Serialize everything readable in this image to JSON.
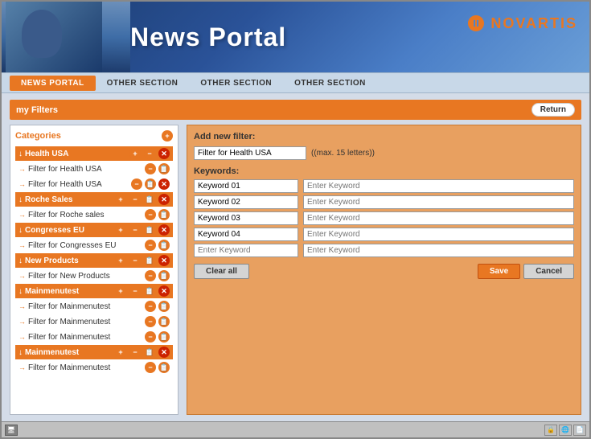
{
  "header": {
    "title": "News Portal",
    "logo_text": "NOVARTIS"
  },
  "nav": {
    "items": [
      {
        "label": "NEWS PORTAL",
        "active": true
      },
      {
        "label": "OTHER SECTION",
        "active": false
      },
      {
        "label": "OTHER SECTION",
        "active": false
      },
      {
        "label": "OTHER SECTION",
        "active": false
      }
    ]
  },
  "page": {
    "my_filters_label": "my Filters",
    "return_label": "Return"
  },
  "categories": {
    "label": "Categories",
    "groups": [
      {
        "name": "Health USA",
        "items": [
          {
            "text": "Filter for Health USA"
          },
          {
            "text": "Filter for Health USA"
          }
        ]
      },
      {
        "name": "Roche Sales",
        "items": [
          {
            "text": "Filter for Roche sales"
          }
        ]
      },
      {
        "name": "Congresses EU",
        "items": [
          {
            "text": "Filter for Congresses EU"
          }
        ]
      },
      {
        "name": "New Products",
        "items": [
          {
            "text": "Filter for New Products"
          }
        ]
      },
      {
        "name": "Mainmenutest",
        "items": [
          {
            "text": "Filter for Mainmenutest"
          },
          {
            "text": "Filter for Mainmenutest"
          },
          {
            "text": "Filter for Mainmenutest"
          }
        ]
      },
      {
        "name": "Mainmenutest",
        "items": [
          {
            "text": "Filter for Mainmenutest"
          }
        ]
      }
    ]
  },
  "add_filter": {
    "title": "Add new filter:",
    "filter_placeholder": "Filter for Health USA",
    "hint": "((max. 15 letters))",
    "keywords_label": "Keywords:",
    "keywords": [
      {
        "name": "Keyword 01",
        "value": "Enter Keyword"
      },
      {
        "name": "Keyword 02",
        "value": "Enter Keyword"
      },
      {
        "name": "Keyword 03",
        "value": "Enter Keyword"
      },
      {
        "name": "Keyword 04",
        "value": "Enter Keyword"
      },
      {
        "name": "Enter Keyword",
        "value": "Enter Keyword"
      }
    ],
    "clear_all": "Clear all",
    "save": "Save",
    "cancel": "Cancel"
  }
}
